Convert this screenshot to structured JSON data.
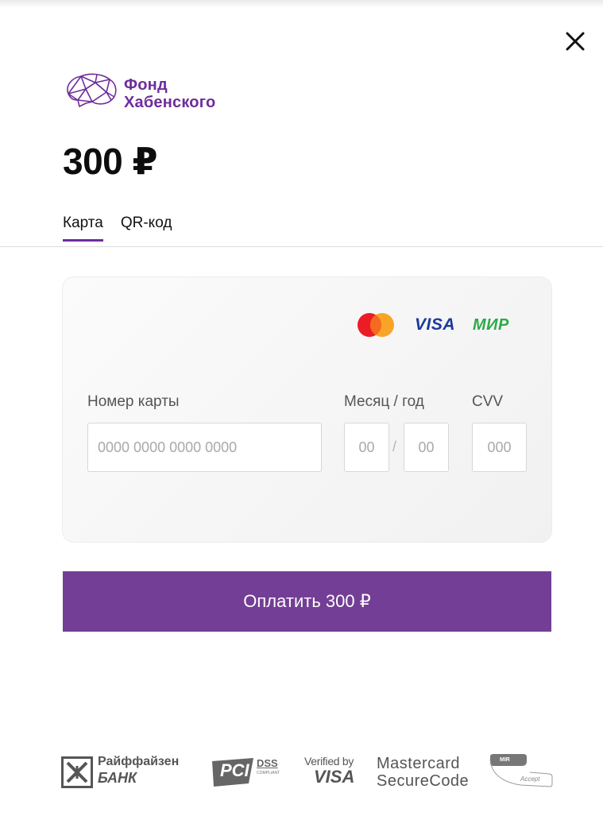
{
  "header": {
    "close_icon": "close-icon"
  },
  "logo": {
    "icon": "brain-icon",
    "line1": "Фонд",
    "line2": "Хабенского",
    "color": "#6e2d9b"
  },
  "amount": "300 ₽",
  "tabs": [
    {
      "label": "Карта",
      "active": true
    },
    {
      "label": "QR-код",
      "active": false
    }
  ],
  "card_form": {
    "brands": {
      "mastercard_icon": "mastercard-icon",
      "visa": "VISA",
      "mir": "МИР"
    },
    "card_number": {
      "label": "Номер карты",
      "placeholder": "0000 0000 0000 0000",
      "value": ""
    },
    "expiry": {
      "label": "Месяц / год",
      "month_placeholder": "00",
      "separator": "/",
      "year_placeholder": "00"
    },
    "cvv": {
      "label": "CVV",
      "placeholder": "000"
    }
  },
  "pay_button": {
    "label": "Оплатить 300 ₽",
    "color": "#733e95"
  },
  "footer": {
    "raiffeisen": {
      "name": "Райффайзен",
      "bank": "БАНК"
    },
    "pci": {
      "pci": "PCI",
      "dss": "DSS",
      "compliant": "COMPLIANT"
    },
    "verified_by_visa": {
      "line1": "Verified by",
      "line2": "VISA"
    },
    "mastercard_securecode": {
      "line1": "Mastercard",
      "line2": "SecureCode"
    },
    "mir_accept": {
      "top": "MIR",
      "bottom": "Accept"
    }
  }
}
